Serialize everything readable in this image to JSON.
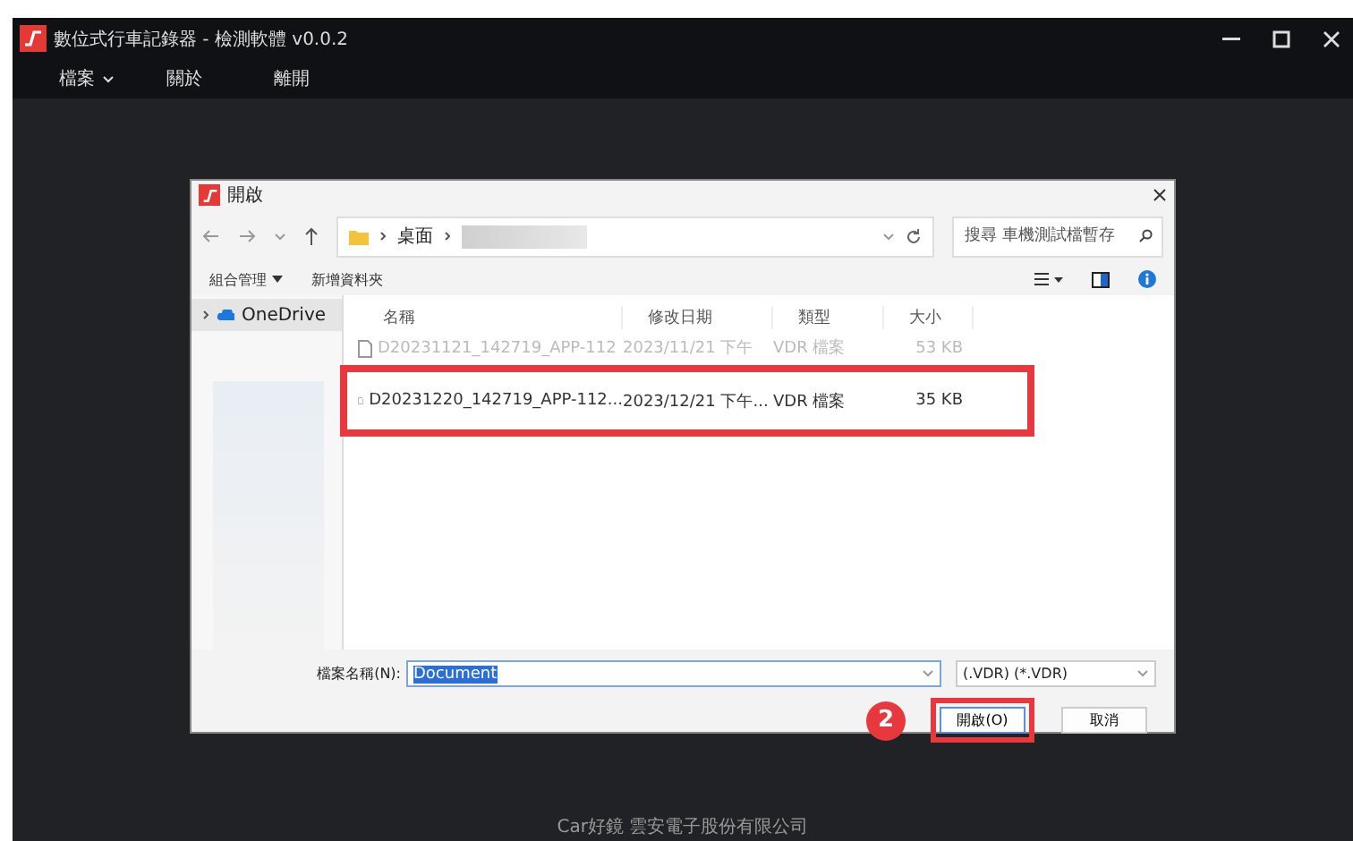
{
  "app": {
    "title": "數位式行車記錄器 - 檢測軟體 v0.0.2"
  },
  "menu": [
    {
      "label": "檔案",
      "dropdown": true
    },
    {
      "label": "關於",
      "dropdown": false
    },
    {
      "label": "離開",
      "dropdown": false
    }
  ],
  "dialog": {
    "title": "開啟",
    "breadcrumb": [
      "桌面"
    ],
    "search": {
      "placeholder": "搜尋 車機測試檔暫存"
    },
    "toolbar": [
      {
        "label": "組合管理",
        "dropdown": true
      },
      {
        "label": "新增資料夾",
        "dropdown": false
      }
    ],
    "sidebar": [
      {
        "label": "OneDrive",
        "selected": true
      }
    ],
    "columns": [
      "名稱",
      "修改日期",
      "類型",
      "大小"
    ],
    "files": [
      {
        "name": "D20231121_142719_APP-112",
        "date": "2023/11/21 下午",
        "type": "VDR 檔案",
        "size": "53 KB",
        "selected": false
      },
      {
        "name": "D20231220_142719_APP-112...",
        "date": "2023/12/21 下午...",
        "type": "VDR 檔案",
        "size": "35 KB",
        "selected": true
      }
    ],
    "filename_label": "檔案名稱(N):",
    "filename": "Document",
    "filter": "(.VDR) (*.VDR)",
    "buttons": [
      {
        "label": "開啟(O)",
        "kind": "primary",
        "highlighted": true
      },
      {
        "label": "取消",
        "kind": "secondary",
        "highlighted": false
      }
    ],
    "step": "2"
  },
  "footer": "Car好鏡 雲安電子股份有限公司"
}
